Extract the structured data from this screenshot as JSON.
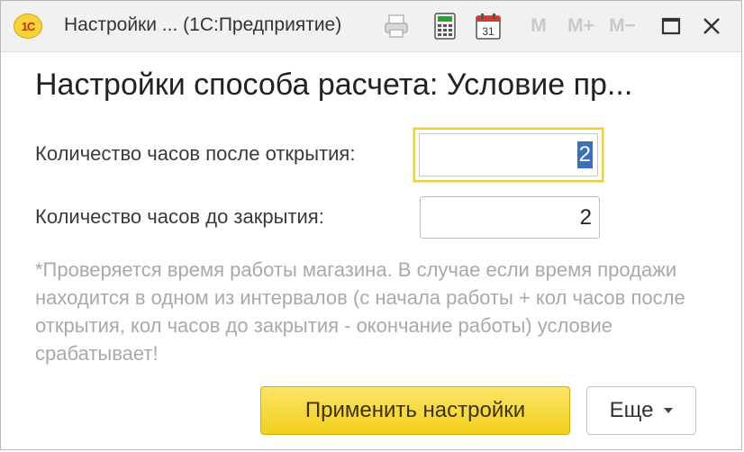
{
  "window": {
    "title": "Настройки ...  (1С:Предприятие)",
    "logo_text": "1С",
    "toolbar": {
      "mem_m": "M",
      "mem_plus": "M+",
      "mem_minus": "M−",
      "calendar_day": "31"
    }
  },
  "dialog": {
    "heading": "Настройки способа расчета: Условие пр...",
    "fields": [
      {
        "label": "Количество часов после открытия:",
        "value": "2"
      },
      {
        "label": "Количество часов до закрытия:",
        "value": "2"
      }
    ],
    "hint": "*Проверяется время работы магазина. В случае если время продажи находится в одном из интервалов (с начала работы + кол часов после открытия, кол часов до закрытия - окончание работы) условие срабатывает!",
    "apply_label": "Применить настройки",
    "more_label": "Еще"
  },
  "colors": {
    "accent_yellow": "#f3cf1c",
    "selection_blue": "#3b6fc0",
    "hint_gray": "#a9a9a9"
  }
}
